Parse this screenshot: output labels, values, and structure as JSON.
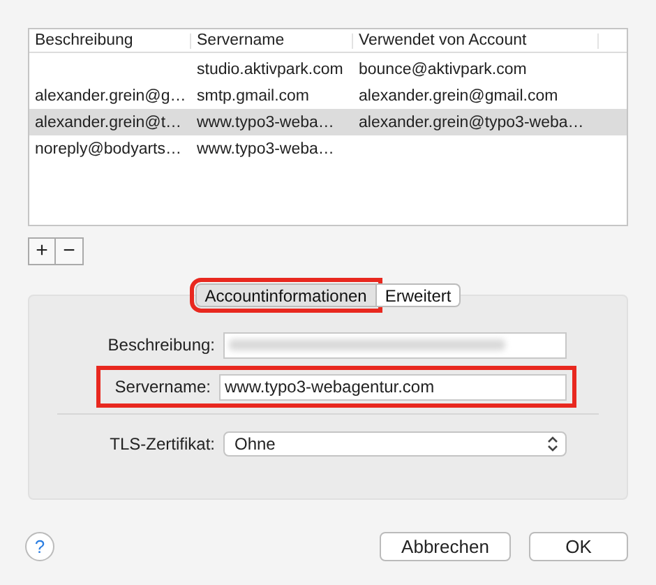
{
  "table": {
    "columns": [
      "Beschreibung",
      "Servername",
      "Verwendet von Account"
    ],
    "rows": [
      {
        "cells": [
          "",
          "studio.aktivpark.com",
          "bounce@aktivpark.com"
        ],
        "selected": false
      },
      {
        "cells": [
          "alexander.grein@g…",
          "smtp.gmail.com",
          "alexander.grein@gmail.com"
        ],
        "selected": false
      },
      {
        "cells": [
          "alexander.grein@t…",
          "www.typo3-weba…",
          "alexander.grein@typo3-weba…"
        ],
        "selected": true
      },
      {
        "cells": [
          "noreply@bodyarts…",
          "www.typo3-weba…",
          ""
        ],
        "selected": false
      }
    ]
  },
  "list_buttons": [
    "+",
    "−"
  ],
  "tabs": [
    {
      "label": "Accountinformationen",
      "selected": true,
      "highlighted": true
    },
    {
      "label": "Erweitert",
      "selected": false,
      "highlighted": false
    }
  ],
  "fields": [
    {
      "kind": "text",
      "label": "Beschreibung:",
      "redacted": true,
      "highlighted": false
    },
    {
      "kind": "text",
      "label": "Servername:",
      "value": "www.typo3-webagentur.com",
      "redacted": false,
      "highlighted": true
    },
    {
      "kind": "popup",
      "label": "TLS-Zertifikat:",
      "value": "Ohne",
      "highlighted": false
    }
  ],
  "help": "?",
  "buttons": [
    "Abbrechen",
    "OK"
  ]
}
